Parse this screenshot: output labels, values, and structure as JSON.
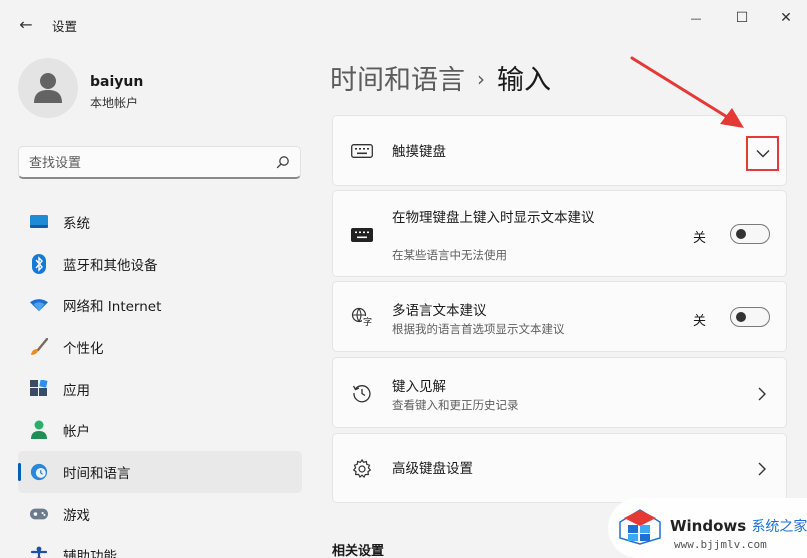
{
  "app": {
    "title": "设置",
    "back_glyph": "←"
  },
  "window": {
    "minimize": "—",
    "maximize": "☐",
    "close": "✕"
  },
  "user": {
    "name": "baiyun",
    "account_type": "本地帐户"
  },
  "search": {
    "placeholder": "查找设置"
  },
  "sidebar": {
    "items": [
      {
        "label": "系统",
        "icon": "monitor-icon"
      },
      {
        "label": "蓝牙和其他设备",
        "icon": "bluetooth-icon"
      },
      {
        "label": "网络和 Internet",
        "icon": "wifi-icon"
      },
      {
        "label": "个性化",
        "icon": "brush-icon"
      },
      {
        "label": "应用",
        "icon": "apps-icon"
      },
      {
        "label": "帐户",
        "icon": "person-icon"
      },
      {
        "label": "时间和语言",
        "icon": "globe-clock-icon",
        "active": true
      },
      {
        "label": "游戏",
        "icon": "gamepad-icon"
      },
      {
        "label": "辅助功能",
        "icon": "accessibility-icon"
      }
    ]
  },
  "header": {
    "parent": "时间和语言",
    "separator": "›",
    "current": "输入"
  },
  "cards": {
    "touch_keyboard": {
      "title": "触摸键盘"
    },
    "show_suggestions_physical": {
      "title": "在物理键盘上键入时显示文本建议",
      "subtitle": "在某些语言中无法使用",
      "state": "关"
    },
    "multilingual": {
      "title": "多语言文本建议",
      "subtitle": "根据我的语言首选项显示文本建议",
      "state": "关"
    },
    "typing_insights": {
      "title": "键入见解",
      "subtitle": "查看键入和更正历史记录"
    },
    "advanced_keyboard": {
      "title": "高级键盘设置"
    }
  },
  "related": {
    "heading": "相关设置"
  },
  "watermark": {
    "brand": "Windows",
    "brand_cn": "系统之家",
    "url": "www.bjjmlv.com"
  },
  "colors": {
    "accent": "#005fb8",
    "annotation": "#e53935",
    "background": "#f3f3f3",
    "card": "#fbfbfb"
  }
}
